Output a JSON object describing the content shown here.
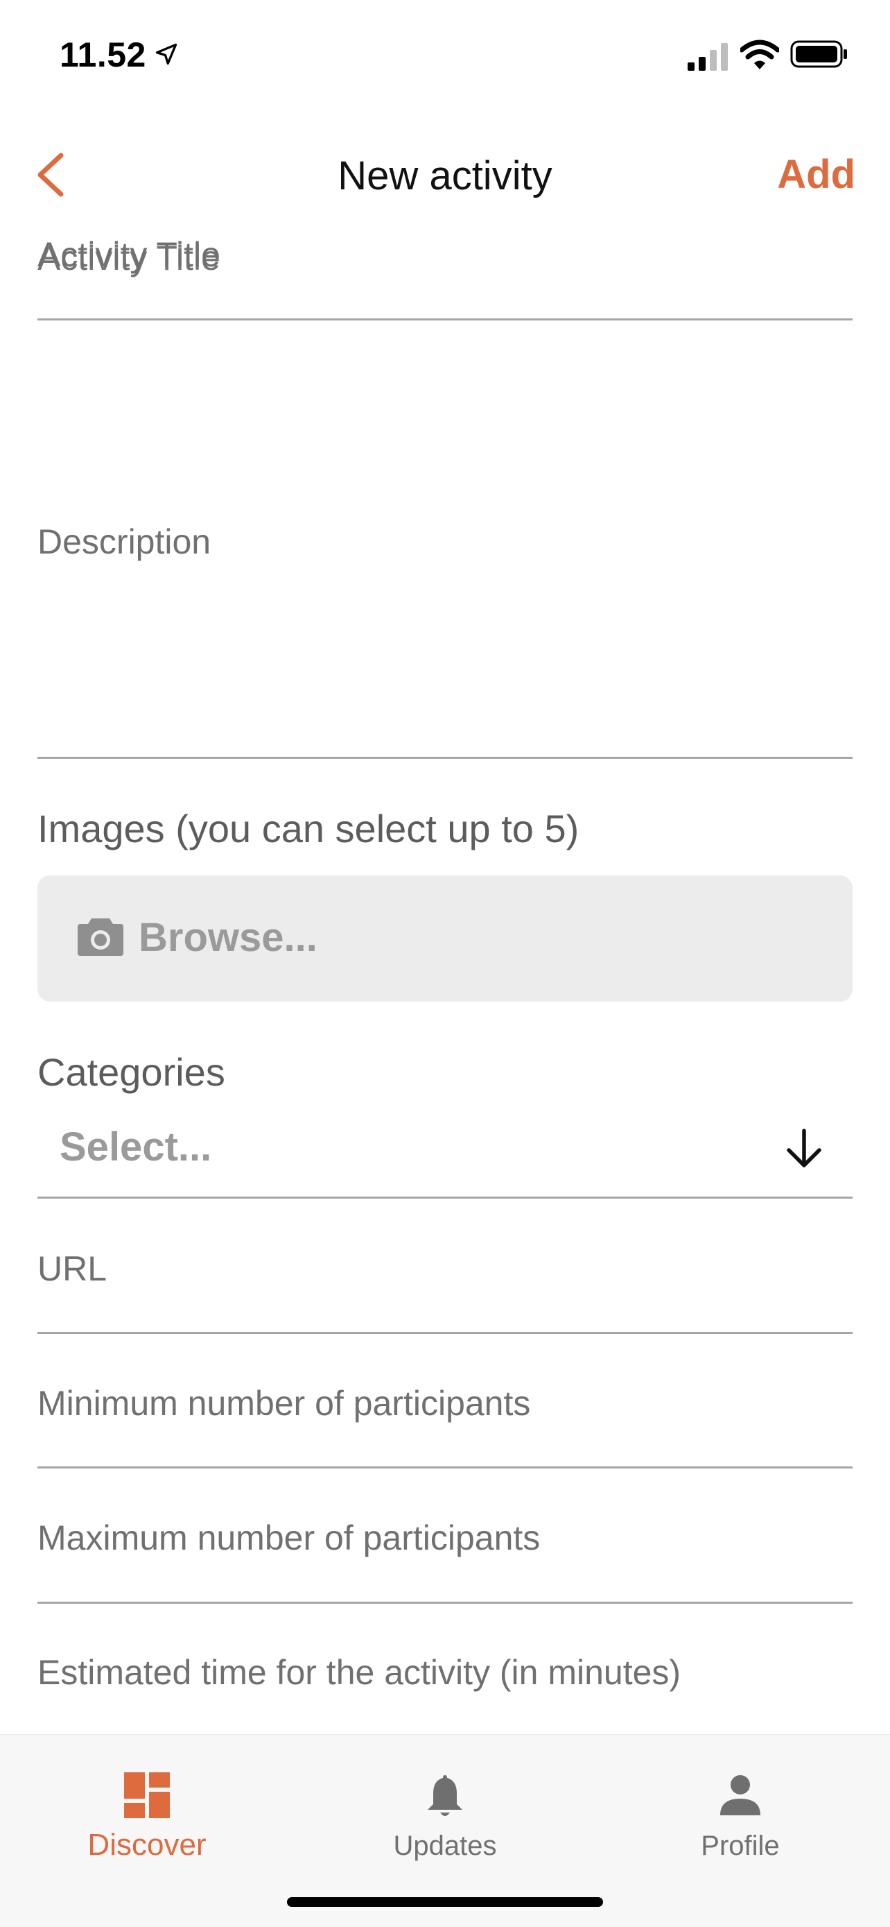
{
  "status_bar": {
    "time": "11.52",
    "icons": [
      "location-arrow-icon",
      "cellular-signal-icon",
      "wifi-icon",
      "battery-icon"
    ]
  },
  "nav": {
    "back_icon": "chevron-left-icon",
    "title": "New activity",
    "add_label": "Add"
  },
  "form": {
    "activity_title": {
      "placeholder": "Activity Title",
      "value": ""
    },
    "description": {
      "placeholder": "Description",
      "value": ""
    },
    "images": {
      "label": "Images (you can select up to 5)",
      "browse_icon": "camera-icon",
      "browse_label": "Browse..."
    },
    "categories": {
      "label": "Categories",
      "selected": "Select...",
      "arrow_icon": "arrow-down-icon"
    },
    "url": {
      "placeholder": "URL",
      "value": ""
    },
    "min_participants": {
      "placeholder": "Minimum number of participants",
      "value": ""
    },
    "max_participants": {
      "placeholder": "Maximum number of participants",
      "value": ""
    },
    "estimated_time": {
      "placeholder": "Estimated time for the activity (in minutes)",
      "value": ""
    }
  },
  "tab_bar": {
    "active": "Discover",
    "tabs": [
      {
        "label": "Discover",
        "icon": "dashboard-icon"
      },
      {
        "label": "Updates",
        "icon": "bell-icon"
      },
      {
        "label": "Profile",
        "icon": "person-icon"
      }
    ]
  },
  "colors": {
    "accent": "#dd6b3e",
    "label_gray": "#707070",
    "divider": "#a6a6a6",
    "browse_bg": "#ececec",
    "tab_bar_bg": "#f7f7f7"
  }
}
